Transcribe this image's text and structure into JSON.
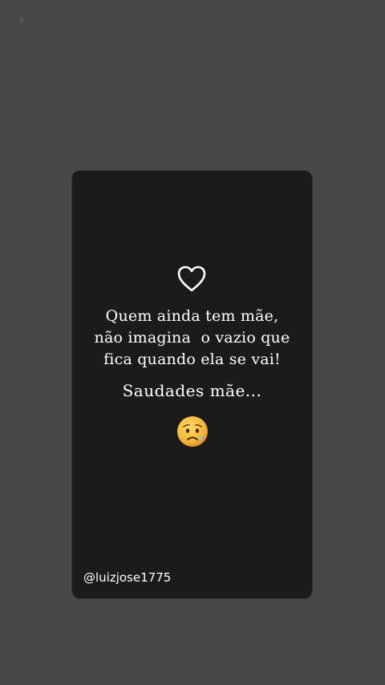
{
  "colors": {
    "background": "#4a4749",
    "card": "#1b1b1b",
    "text": "#ffffff",
    "emoji_face": "#f4b63a"
  },
  "icons": {
    "heart": "white-heart-outline-icon",
    "emoji": "worried-face-emoji"
  },
  "story": {
    "quote_lines": [
      "Quem ainda tem mãe,",
      "não imagina  o vazio que",
      "fica quando ela se vai!"
    ],
    "subtitle": "Saudades mãe...",
    "handle": "@luizjose1775"
  }
}
